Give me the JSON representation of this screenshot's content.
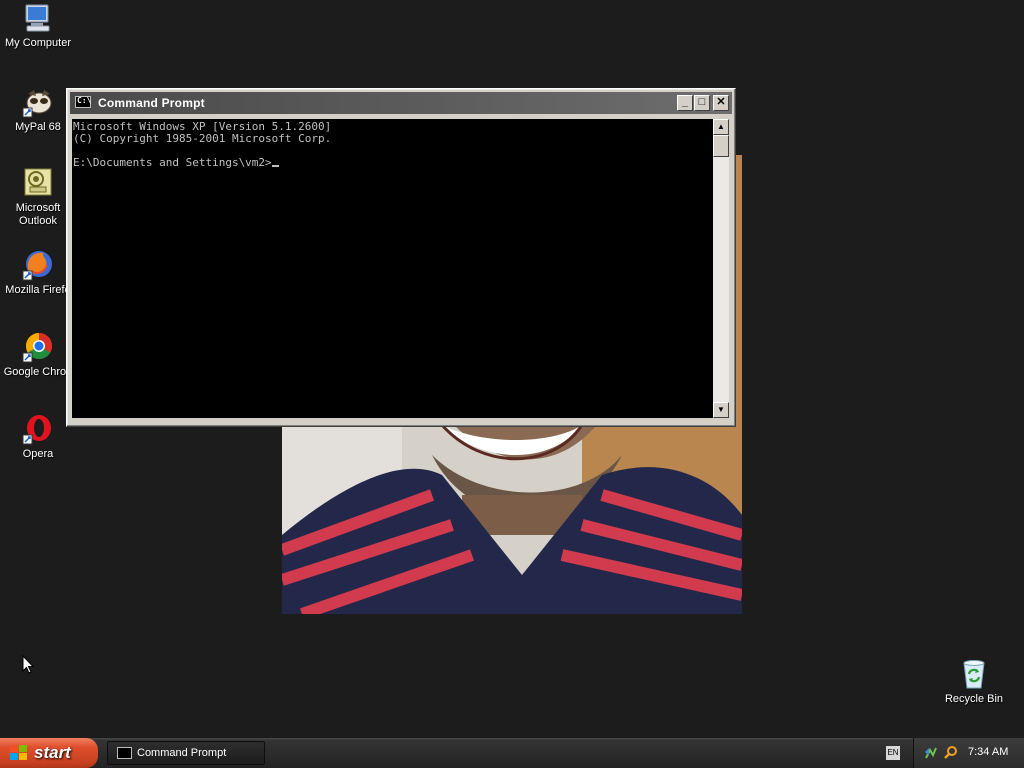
{
  "desktop": {
    "icons": [
      {
        "label": "My Computer",
        "icon": "computer-icon"
      },
      {
        "label": "MyPal 68",
        "icon": "mypal-icon"
      },
      {
        "label": "Microsoft Outlook",
        "icon": "outlook-icon"
      },
      {
        "label": "Mozilla Firefo",
        "icon": "firefox-icon"
      },
      {
        "label": "Google Chron",
        "icon": "chrome-icon"
      },
      {
        "label": "Opera",
        "icon": "opera-icon"
      },
      {
        "label": "Recycle Bin",
        "icon": "recycle-bin-icon"
      }
    ],
    "wallpaper_photo": "person-smiling-photo"
  },
  "window": {
    "title": "Command Prompt",
    "minimize_glyph": "_",
    "maximize_glyph": "□",
    "close_glyph": "✕",
    "console_lines": [
      "Microsoft Windows XP [Version 5.1.2600]",
      "(C) Copyright 1985-2001 Microsoft Corp.",
      "",
      "E:\\Documents and Settings\\vm2>"
    ]
  },
  "taskbar": {
    "start_label": "start",
    "task_button_label": "Command Prompt",
    "language": "EN",
    "clock": "7:34 AM"
  },
  "colors": {
    "desktop_bg": "#1c1c1c",
    "console_bg": "#000000",
    "console_text": "#c0c0c0",
    "start_button": "#d24a28"
  }
}
